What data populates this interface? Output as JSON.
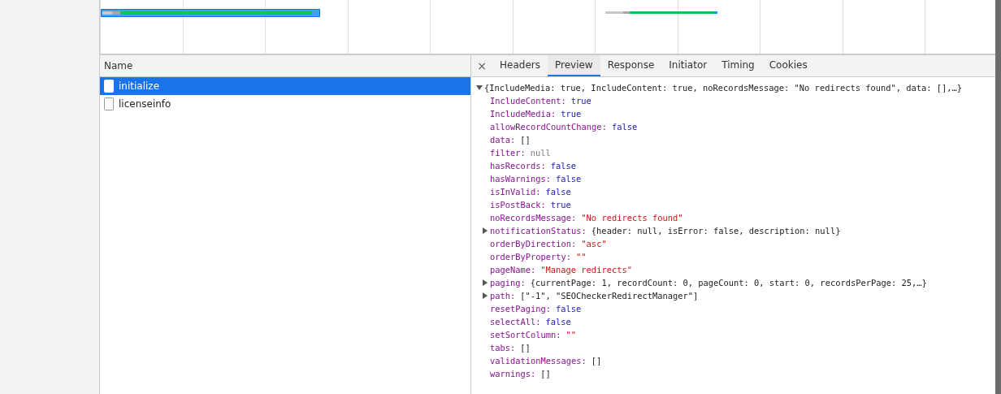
{
  "requests_header": "Name",
  "requests": [
    {
      "name": "initialize",
      "selected": true
    },
    {
      "name": "licenseinfo",
      "selected": false
    }
  ],
  "detail_close": "×",
  "tabs": [
    {
      "label": "Headers",
      "selected": false
    },
    {
      "label": "Preview",
      "selected": true
    },
    {
      "label": "Response",
      "selected": false
    },
    {
      "label": "Initiator",
      "selected": false
    },
    {
      "label": "Timing",
      "selected": false
    },
    {
      "label": "Cookies",
      "selected": false
    }
  ],
  "preview": {
    "summary": "{IncludeMedia: true, IncludeContent: true, noRecordsMessage: \"No redirects found\", data: [],…}",
    "expanded": true,
    "children": [
      {
        "key": "IncludeContent:",
        "value": "true",
        "kind": "bool"
      },
      {
        "key": "IncludeMedia:",
        "value": "true",
        "kind": "bool"
      },
      {
        "key": "allowRecordCountChange:",
        "value": "false",
        "kind": "bool"
      },
      {
        "key": "data:",
        "value": "[]",
        "kind": "object"
      },
      {
        "key": "filter:",
        "value": "null",
        "kind": "null"
      },
      {
        "key": "hasRecords:",
        "value": "false",
        "kind": "bool"
      },
      {
        "key": "hasWarnings:",
        "value": "false",
        "kind": "bool"
      },
      {
        "key": "isInValid:",
        "value": "false",
        "kind": "bool"
      },
      {
        "key": "isPostBack:",
        "value": "true",
        "kind": "bool"
      },
      {
        "key": "noRecordsMessage:",
        "value": "\"No redirects found\"",
        "kind": "string"
      },
      {
        "key": "notificationStatus:",
        "value": "{header: null, isError: false, description: null}",
        "kind": "object",
        "expanded": false
      },
      {
        "key": "orderByDirection:",
        "value": "\"asc\"",
        "kind": "string"
      },
      {
        "key": "orderByProperty:",
        "value": "\"\"",
        "kind": "string"
      },
      {
        "key": "pageName:",
        "value": "\"Manage redirects\"",
        "kind": "string"
      },
      {
        "key": "paging:",
        "value": "{currentPage: 1, recordCount: 0, pageCount: 0, start: 0, recordsPerPage: 25,…}",
        "kind": "object",
        "expanded": false
      },
      {
        "key": "path:",
        "value": "[\"-1\", \"SEOCheckerRedirectManager\"]",
        "kind": "object",
        "expanded": false
      },
      {
        "key": "resetPaging:",
        "value": "false",
        "kind": "bool"
      },
      {
        "key": "selectAll:",
        "value": "false",
        "kind": "bool"
      },
      {
        "key": "setSortColumn:",
        "value": "\"\"",
        "kind": "string"
      },
      {
        "key": "tabs:",
        "value": "[]",
        "kind": "object"
      },
      {
        "key": "validationMessages:",
        "value": "[]",
        "kind": "object"
      },
      {
        "key": "warnings:",
        "value": "[]",
        "kind": "object"
      }
    ]
  }
}
